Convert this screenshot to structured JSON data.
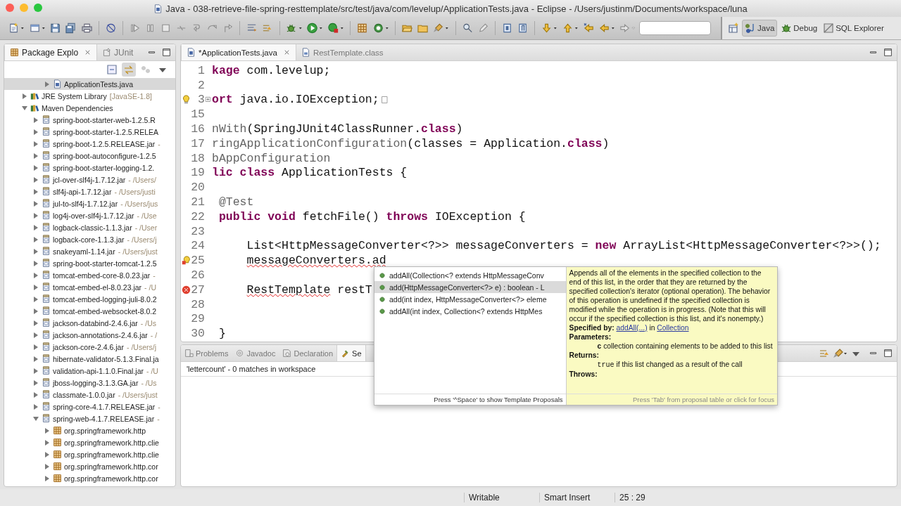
{
  "window": {
    "title": "Java - 038-retrieve-file-spring-resttemplate/src/test/java/com/levelup/ApplicationTests.java - Eclipse - /Users/justinm/Documents/workspace/luna"
  },
  "toolbar": {
    "buttons": [
      {
        "kind": "new",
        "menu": true,
        "disabled": false
      },
      {
        "kind": "newwin",
        "menu": true,
        "disabled": false
      },
      {
        "kind": "save",
        "disabled": false
      },
      {
        "kind": "saveall",
        "disabled": false
      },
      {
        "kind": "print",
        "disabled": false
      },
      {
        "kind": "separator"
      },
      {
        "kind": "nobreak",
        "disabled": false
      },
      {
        "kind": "separator"
      },
      {
        "kind": "resume",
        "disabled": true
      },
      {
        "kind": "suspend",
        "disabled": true
      },
      {
        "kind": "stop",
        "disabled": true
      },
      {
        "kind": "disconnect",
        "disabled": true
      },
      {
        "kind": "stepinto",
        "disabled": true
      },
      {
        "kind": "stepover",
        "disabled": true
      },
      {
        "kind": "stepreturn",
        "disabled": true
      },
      {
        "kind": "separator"
      },
      {
        "kind": "lines",
        "disabled": false
      },
      {
        "kind": "format",
        "disabled": false
      },
      {
        "kind": "separator"
      },
      {
        "kind": "bug",
        "menu": true,
        "disabled": false
      },
      {
        "kind": "run",
        "menu": true,
        "disabled": false
      },
      {
        "kind": "runext",
        "menu": true,
        "disabled": false
      },
      {
        "kind": "separator"
      },
      {
        "kind": "package",
        "disabled": false
      },
      {
        "kind": "classnew",
        "menu": true,
        "disabled": false
      },
      {
        "kind": "separator"
      },
      {
        "kind": "folderopen",
        "disabled": false
      },
      {
        "kind": "folder",
        "disabled": false
      },
      {
        "kind": "brush",
        "menu": true,
        "disabled": false
      },
      {
        "kind": "separator"
      },
      {
        "kind": "searchref",
        "disabled": false
      },
      {
        "kind": "pencil",
        "disabled": true
      },
      {
        "kind": "separator"
      },
      {
        "kind": "block",
        "disabled": false
      },
      {
        "kind": "para",
        "disabled": false
      },
      {
        "kind": "separator"
      },
      {
        "kind": "down",
        "menu": true,
        "disabled": false
      },
      {
        "kind": "up",
        "menu": true,
        "disabled": false
      },
      {
        "kind": "backedit",
        "disabled": false
      },
      {
        "kind": "back",
        "menu": true,
        "disabled": false
      },
      {
        "kind": "forward",
        "menu": true,
        "disabled": true
      }
    ],
    "perspectives": [
      {
        "label": "Java",
        "kind": "javap",
        "selected": true
      },
      {
        "label": "Debug",
        "kind": "bug",
        "selected": false
      },
      {
        "label": "SQL Explorer",
        "kind": "sqlp",
        "selected": false
      }
    ]
  },
  "left_panel": {
    "tabs": [
      {
        "label": "Package Explo",
        "kind": "package",
        "selected": true,
        "closable": true
      },
      {
        "label": "JUnit",
        "kind": "junit",
        "selected": false,
        "closable": false
      }
    ],
    "continued_items": [
      {
        "label": "ApplicationTests.java",
        "kind": "java",
        "expanded": false,
        "selected": true
      }
    ],
    "tree": [
      {
        "label": "JRE System Library",
        "suffix": "[JavaSE-1.8]",
        "kind": "library",
        "expanded": false,
        "selected": false
      },
      {
        "label": "Maven Dependencies",
        "kind": "library",
        "expanded": true,
        "selected": false,
        "children": [
          {
            "label": "spring-boot-starter-web-1.2.5.R",
            "kind": "jar",
            "expanded": false,
            "selected": false
          },
          {
            "label": "spring-boot-starter-1.2.5.RELEA",
            "kind": "jar",
            "expanded": false,
            "selected": false
          },
          {
            "label": "spring-boot-1.2.5.RELEASE.jar",
            "suffix": "-",
            "kind": "jar",
            "expanded": false,
            "selected": false
          },
          {
            "label": "spring-boot-autoconfigure-1.2.5",
            "kind": "jar",
            "expanded": false,
            "selected": false
          },
          {
            "label": "spring-boot-starter-logging-1.2.",
            "kind": "jar",
            "expanded": false,
            "selected": false
          },
          {
            "label": "jcl-over-slf4j-1.7.12.jar",
            "suffix": "- /Users/",
            "kind": "jar",
            "expanded": false,
            "selected": false
          },
          {
            "label": "slf4j-api-1.7.12.jar",
            "suffix": "- /Users/justi",
            "kind": "jar",
            "expanded": false,
            "selected": false
          },
          {
            "label": "jul-to-slf4j-1.7.12.jar",
            "suffix": "- /Users/jus",
            "kind": "jar",
            "expanded": false,
            "selected": false
          },
          {
            "label": "log4j-over-slf4j-1.7.12.jar",
            "suffix": "- /Use",
            "kind": "jar",
            "expanded": false,
            "selected": false
          },
          {
            "label": "logback-classic-1.1.3.jar",
            "suffix": "- /User",
            "kind": "jar",
            "expanded": false,
            "selected": false
          },
          {
            "label": "logback-core-1.1.3.jar",
            "suffix": "- /Users/j",
            "kind": "jar",
            "expanded": false,
            "selected": false
          },
          {
            "label": "snakeyaml-1.14.jar",
            "suffix": "- /Users/just",
            "kind": "jar",
            "expanded": false,
            "selected": false
          },
          {
            "label": "spring-boot-starter-tomcat-1.2.5",
            "kind": "jar",
            "expanded": false,
            "selected": false
          },
          {
            "label": "tomcat-embed-core-8.0.23.jar",
            "suffix": "-",
            "kind": "jar",
            "expanded": false,
            "selected": false
          },
          {
            "label": "tomcat-embed-el-8.0.23.jar",
            "suffix": "- /U",
            "kind": "jar",
            "expanded": false,
            "selected": false
          },
          {
            "label": "tomcat-embed-logging-juli-8.0.2",
            "kind": "jar",
            "expanded": false,
            "selected": false
          },
          {
            "label": "tomcat-embed-websocket-8.0.2",
            "kind": "jar",
            "expanded": false,
            "selected": false
          },
          {
            "label": "jackson-databind-2.4.6.jar",
            "suffix": "- /Us",
            "kind": "jar",
            "expanded": false,
            "selected": false
          },
          {
            "label": "jackson-annotations-2.4.6.jar",
            "suffix": "- /",
            "kind": "jar",
            "expanded": false,
            "selected": false
          },
          {
            "label": "jackson-core-2.4.6.jar",
            "suffix": "- /Users/j",
            "kind": "jar",
            "expanded": false,
            "selected": false
          },
          {
            "label": "hibernate-validator-5.1.3.Final.ja",
            "kind": "jar",
            "expanded": false,
            "selected": false
          },
          {
            "label": "validation-api-1.1.0.Final.jar",
            "suffix": "- /U",
            "kind": "jar",
            "expanded": false,
            "selected": false
          },
          {
            "label": "jboss-logging-3.1.3.GA.jar",
            "suffix": "- /Us",
            "kind": "jar",
            "expanded": false,
            "selected": false
          },
          {
            "label": "classmate-1.0.0.jar",
            "suffix": "- /Users/just",
            "kind": "jar",
            "expanded": false,
            "selected": false
          },
          {
            "label": "spring-core-4.1.7.RELEASE.jar",
            "suffix": "-",
            "kind": "jar",
            "expanded": false,
            "selected": false
          },
          {
            "label": "spring-web-4.1.7.RELEASE.jar",
            "suffix": "-",
            "kind": "jar",
            "expanded": true,
            "selected": false,
            "children": [
              {
                "label": "org.springframework.http",
                "kind": "pkg",
                "expanded": false,
                "selected": false
              },
              {
                "label": "org.springframework.http.clie",
                "kind": "pkg",
                "expanded": false,
                "selected": false
              },
              {
                "label": "org.springframework.http.clie",
                "kind": "pkg",
                "expanded": false,
                "selected": false
              },
              {
                "label": "org.springframework.http.cor",
                "kind": "pkg",
                "expanded": false,
                "selected": false
              },
              {
                "label": "org.springframework.http.cor",
                "kind": "pkg",
                "expanded": false,
                "selected": false
              }
            ]
          }
        ]
      }
    ]
  },
  "editor": {
    "tabs": [
      {
        "label": "*ApplicationTests.java",
        "kind": "java",
        "selected": true,
        "closable": true
      },
      {
        "label": "RestTemplate.class",
        "kind": "classfile",
        "selected": false,
        "closable": false
      }
    ],
    "lines": [
      {
        "number": "1",
        "tokens": [
          {
            "text": "kage",
            "kind": "keyword"
          },
          {
            "text": " com.levelup;",
            "kind": "plain"
          }
        ]
      },
      {
        "number": "2"
      },
      {
        "number": "3",
        "folded": true,
        "kind": "quickfix",
        "tokens": [
          {
            "text": "ort",
            "kind": "keyword"
          },
          {
            "text": " java.io.IOException;",
            "kind": "plain"
          }
        ]
      },
      {
        "number": "15"
      },
      {
        "number": "16",
        "tokens": [
          {
            "text": "nWith",
            "kind": "annotation"
          },
          {
            "text": "(SpringJUnit4ClassRunner.",
            "kind": "plain"
          },
          {
            "text": "class",
            "kind": "keyword"
          },
          {
            "text": ")",
            "kind": "plain"
          }
        ]
      },
      {
        "number": "17",
        "tokens": [
          {
            "text": "ringApplicationConfiguration",
            "kind": "annotation"
          },
          {
            "text": "(classes = Application.",
            "kind": "plain"
          },
          {
            "text": "class",
            "kind": "keyword"
          },
          {
            "text": ")",
            "kind": "plain"
          }
        ]
      },
      {
        "number": "18",
        "tokens": [
          {
            "text": "bAppConfiguration",
            "kind": "annotation"
          }
        ]
      },
      {
        "number": "19",
        "tokens": [
          {
            "text": "lic class",
            "kind": "keyword"
          },
          {
            "text": " ApplicationTests {",
            "kind": "plain"
          }
        ]
      },
      {
        "number": "20"
      },
      {
        "number": "21",
        "tokens": [
          {
            "text": " @Test",
            "kind": "annotation"
          }
        ]
      },
      {
        "number": "22",
        "tokens": [
          {
            "text": " public void",
            "kind": "keyword"
          },
          {
            "text": " fetchFile() ",
            "kind": "plain"
          },
          {
            "text": "throws",
            "kind": "keyword"
          },
          {
            "text": " IOException {",
            "kind": "plain"
          }
        ]
      },
      {
        "number": "23"
      },
      {
        "number": "24",
        "tokens": [
          {
            "text": "     List<HttpMessageConverter<?>> messageConverters = ",
            "kind": "plain"
          },
          {
            "text": "new",
            "kind": "keyword"
          },
          {
            "text": " ArrayList<HttpMessageConverter<?>>();",
            "kind": "plain"
          }
        ]
      },
      {
        "number": "25",
        "kind": "errorfix",
        "tokens": [
          {
            "text": "     messageConverters.ad",
            "kind": "error"
          }
        ]
      },
      {
        "number": "26"
      },
      {
        "number": "27",
        "kind": "error",
        "tokens": [
          {
            "text": "     RestTemplate",
            "kind": "error"
          },
          {
            "text": " restT",
            "kind": "plain"
          }
        ]
      },
      {
        "number": "28"
      },
      {
        "number": "29"
      },
      {
        "number": "30",
        "tokens": [
          {
            "text": " }",
            "kind": "plain"
          }
        ]
      }
    ]
  },
  "bottom_panel": {
    "tabs": [
      {
        "label": "Problems",
        "kind": "problems",
        "selected": false
      },
      {
        "label": "Javadoc",
        "kind": "javadoc",
        "selected": false
      },
      {
        "label": "Declaration",
        "kind": "declaration",
        "selected": false
      },
      {
        "label": "Se",
        "kind": "search",
        "selected": true
      }
    ],
    "message": "'lettercount' - 0 matches in workspace"
  },
  "content_assist": {
    "proposals": [
      {
        "label": "addAll(Collection<? extends HttpMessageConv",
        "selected": false
      },
      {
        "label": "add(HttpMessageConverter<?> e) : boolean - L",
        "selected": true
      },
      {
        "label": "add(int index, HttpMessageConverter<?> eleme",
        "selected": false
      },
      {
        "label": "addAll(int index, Collection<? extends HttpMes",
        "selected": false
      }
    ],
    "footer": "Press '^Space' to show Template Proposals",
    "doc": {
      "description": "Appends all of the elements in the specified collection to the end of this list, in the order that they are returned by the specified collection's iterator (optional operation). The behavior of this operation is undefined if the specified collection is modified while the operation is in progress. (Note that this will occur if the specified collection is this list, and it's nonempty.)",
      "specified_by": {
        "label": "Specified by:",
        "method_link": "addAll(...)",
        "connector": "in",
        "type_link": "Collection"
      },
      "parameters_heading": "Parameters:",
      "parameter": "**c** collection containing elements to be added to this list",
      "returns_heading": "Returns:",
      "returns_code": "true",
      "returns_text": "if this list changed as a result of the call",
      "throws_heading": "Throws:",
      "footer": "Press 'Tab' from proposal table or click for focus"
    }
  },
  "status_bar": [
    "Writable",
    "Smart Insert",
    "25 : 29"
  ]
}
